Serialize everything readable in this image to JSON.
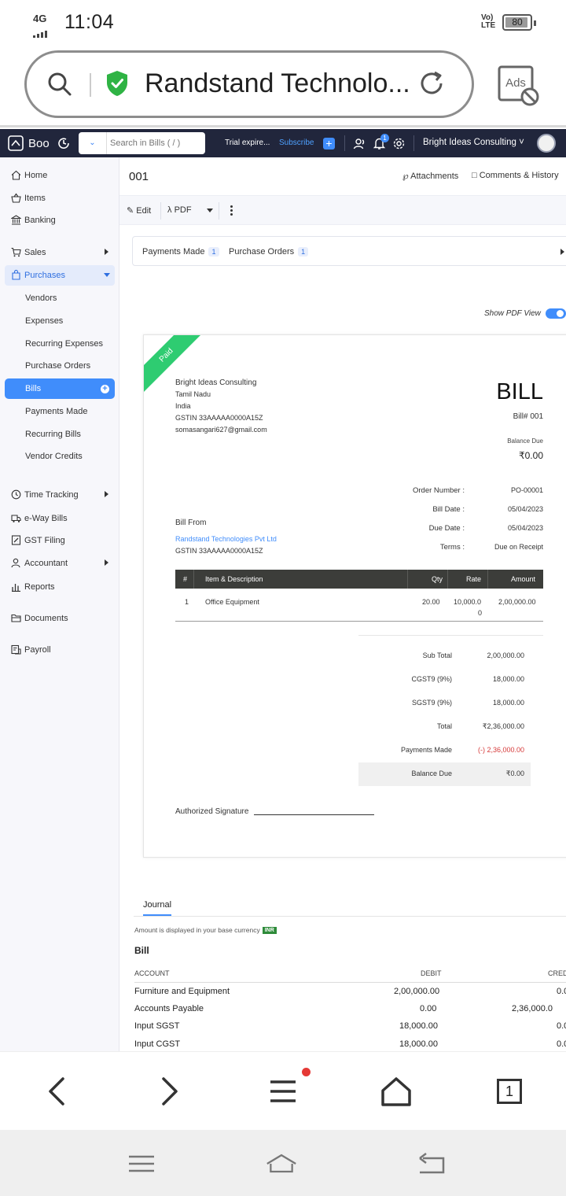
{
  "status_bar": {
    "network": "4G",
    "time": "11:04",
    "volte": "Vo) LTE",
    "battery": "80"
  },
  "browser": {
    "url_title": "Randstand Technolo...",
    "ads_label": "Ads",
    "tabs_count": "1"
  },
  "app": {
    "name": "Boo",
    "search_placeholder": "Search in Bills ( / )",
    "trial_text": "Trial expire...",
    "subscribe_label": "Subscribe",
    "notification_count": "1",
    "organization": "Bright Ideas Consulting",
    "accent_color": "#408dfb",
    "topbar_color": "#21263c"
  },
  "sidebar": {
    "items": [
      {
        "label": "Home",
        "icon": "home-icon"
      },
      {
        "label": "Items",
        "icon": "basket-icon"
      },
      {
        "label": "Banking",
        "icon": "bank-icon"
      },
      {
        "label": "Sales",
        "icon": "cart-icon"
      },
      {
        "label": "Purchases",
        "icon": "bag-icon"
      },
      {
        "label": "Time Tracking",
        "icon": "clock-icon"
      },
      {
        "label": "e-Way Bills",
        "icon": "truck-icon"
      },
      {
        "label": "GST Filing",
        "icon": "gst-icon"
      },
      {
        "label": "Accountant",
        "icon": "accountant-icon"
      },
      {
        "label": "Reports",
        "icon": "reports-icon"
      },
      {
        "label": "Documents",
        "icon": "folder-icon"
      },
      {
        "label": "Payroll",
        "icon": "payroll-icon"
      }
    ],
    "purchase_sub_items": [
      "Vendors",
      "Expenses",
      "Recurring Expenses",
      "Purchase Orders",
      "Bills",
      "Payments Made",
      "Recurring Bills",
      "Vendor Credits"
    ]
  },
  "bill": {
    "number_title": "001",
    "attachments_label": "Attachments",
    "comments_label": "Comments & History",
    "edit_label": "Edit",
    "pdf_label": "PDF",
    "related": [
      {
        "label": "Payments Made",
        "count": "1"
      },
      {
        "label": "Purchase Orders",
        "count": "1"
      }
    ],
    "show_pdf_label": "Show PDF View",
    "show_pdf_on": true,
    "status_ribbon": "Paid",
    "org_name": "Bright Ideas Consulting",
    "org_state": "Tamil Nadu",
    "org_country": "India",
    "org_gstin": "GSTIN 33AAAAA0000A15Z",
    "org_email": "somasangari627@gmail.com",
    "doc_title": "BILL",
    "bill_number": "Bill# 001",
    "balance_due_label": "Balance Due",
    "balance_due_value": "₹0.00",
    "meta": [
      {
        "label": "Order Number :",
        "value": "PO-00001"
      },
      {
        "label": "Bill Date :",
        "value": "05/04/2023"
      },
      {
        "label": "Due Date :",
        "value": "05/04/2023"
      },
      {
        "label": "Terms :",
        "value": "Due on Receipt"
      }
    ],
    "bill_from_label": "Bill From",
    "vendor_name": "Randstand Technologies Pvt Ltd",
    "vendor_gstin": "GSTIN 33AAAAA0000A15Z",
    "columns": {
      "num": "#",
      "item": "Item & Description",
      "qty": "Qty",
      "rate": "Rate",
      "amount": "Amount"
    },
    "items": [
      {
        "num": "1",
        "item": "Office Equipment",
        "qty": "20.00",
        "rate_line1": "10,000.0",
        "rate_line2": "0",
        "amount": "2,00,000.00"
      }
    ],
    "totals": [
      {
        "label": "Sub Total",
        "value": "2,00,000.00"
      },
      {
        "label": "CGST9 (9%)",
        "value": "18,000.00"
      },
      {
        "label": "SGST9 (9%)",
        "value": "18,000.00"
      },
      {
        "label": "Total",
        "value": "₹2,36,000.00"
      },
      {
        "label": "Payments Made",
        "value": "(-) 2,36,000.00"
      },
      {
        "label": "Balance Due",
        "value": "₹0.00"
      }
    ],
    "signature_label": "Authorized Signature"
  },
  "journal": {
    "tab_label": "Journal",
    "note": "Amount is displayed in your base currency",
    "currency": "INR",
    "title": "Bill",
    "columns": {
      "account": "ACCOUNT",
      "debit": "DEBIT",
      "credit": "CRED"
    },
    "rows": [
      {
        "account": "Furniture and Equipment",
        "debit": "2,00,000.00",
        "credit": "0.0"
      },
      {
        "account": "Accounts Payable",
        "debit": "0.00",
        "credit": "2,36,000.0"
      },
      {
        "account": "Input SGST",
        "debit": "18,000.00",
        "credit": "0.0"
      },
      {
        "account": "Input CGST",
        "debit": "18,000.00",
        "credit": "0.0"
      }
    ]
  }
}
